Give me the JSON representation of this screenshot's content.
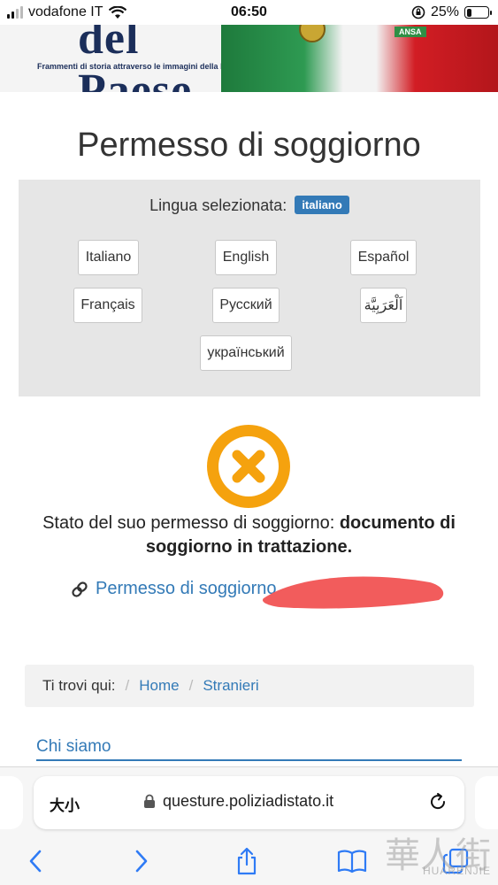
{
  "status_bar": {
    "carrier": "vodafone IT",
    "time": "06:50",
    "battery": "25%",
    "battery_level": 0.25
  },
  "banner": {
    "brand": "del Paese",
    "subtitle": "Frammenti di storia attraverso le immagini della Polizia",
    "agency": "ANSA"
  },
  "page": {
    "title": "Permesso di soggiorno"
  },
  "language": {
    "label": "Lingua selezionata:",
    "selected": "italiano",
    "options": [
      "Italiano",
      "English",
      "Español",
      "Français",
      "Русский",
      "اَلْعَرَبِيَّة",
      "український"
    ]
  },
  "status": {
    "prefix": "Stato del suo permesso di soggiorno:",
    "value": "documento di soggiorno in trattazione.",
    "link_text": "Permesso di soggiorno"
  },
  "breadcrumb": {
    "label": "Ti trovi qui:",
    "items": [
      "Home",
      "Stranieri"
    ]
  },
  "section": {
    "chi_siamo": "Chi siamo"
  },
  "browser": {
    "text_size_label": "大小",
    "url": "questure.poliziadistato.it"
  },
  "watermark": {
    "main": "華人街",
    "sub": "HUARENJIE"
  },
  "colors": {
    "accent": "#337ab7",
    "warning": "#f5a20e",
    "redaction": "#f25c5c"
  }
}
